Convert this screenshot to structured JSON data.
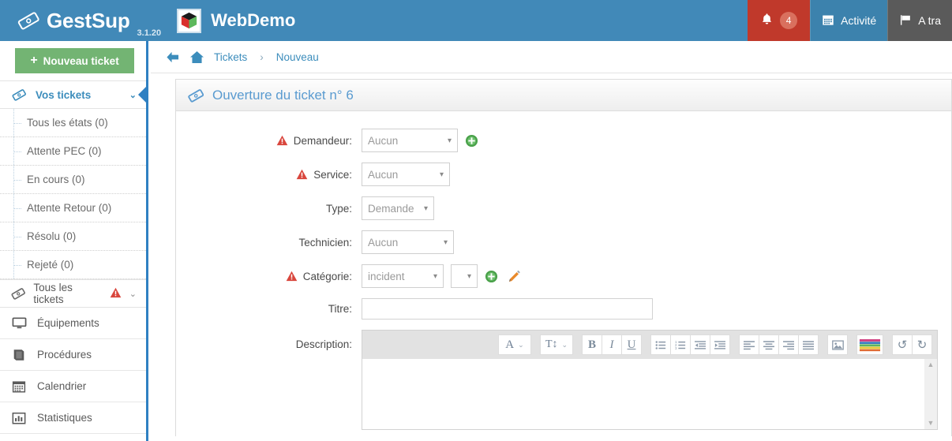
{
  "header": {
    "brand_name": "GestSup",
    "brand_version": "3.1.20",
    "brand_icon": "ticket-icon",
    "site_name": "WebDemo",
    "site_logo_icon": "cube-logo-icon",
    "notifications": {
      "icon": "bell-icon",
      "count": "4"
    },
    "activity": {
      "icon": "calendar-icon",
      "label": "Activité"
    },
    "flag_item": {
      "icon": "flag-icon",
      "label": "A tra"
    },
    "bg_color": "#4189b8",
    "notif_bg_color": "#c0392b",
    "flag_bg_color": "#5a5a5a"
  },
  "sidebar": {
    "new_ticket_button": {
      "label": "Nouveau ticket",
      "icon": "plus-icon",
      "color": "#73b473"
    },
    "groups": {
      "vos_tickets": {
        "label": "Vos tickets",
        "icon": "ticket-icon",
        "chevron": "chevron-down-icon"
      },
      "tous_les_tickets": {
        "label": "Tous les tickets",
        "icon": "ticket-icon",
        "warning": "warning-triangle-icon",
        "chevron": "chevron-down-icon"
      }
    },
    "sub_items": [
      {
        "label": "Tous les états (0)"
      },
      {
        "label": "Attente PEC (0)"
      },
      {
        "label": "En cours (0)"
      },
      {
        "label": "Attente Retour (0)"
      },
      {
        "label": "Résolu (0)"
      },
      {
        "label": "Rejeté (0)"
      }
    ],
    "items": [
      {
        "label": "Équipements",
        "icon": "monitor-icon"
      },
      {
        "label": "Procédures",
        "icon": "book-icon"
      },
      {
        "label": "Calendrier",
        "icon": "calendar-icon"
      },
      {
        "label": "Statistiques",
        "icon": "bar-chart-icon"
      }
    ],
    "accent_color": "#2f80c2"
  },
  "breadcrumb": {
    "back_icon": "arrow-left-icon",
    "home_icon": "home-icon",
    "items": [
      "Tickets",
      "Nouveau"
    ],
    "separator": "›"
  },
  "panel": {
    "title": "Ouverture du ticket n° 6",
    "title_icon": "ticket-icon"
  },
  "form": {
    "rows": [
      {
        "label": "Demandeur:",
        "required": true,
        "value": "Aucun",
        "add_icon": "add-circle-icon"
      },
      {
        "label": "Service:",
        "required": true,
        "value": "Aucun"
      },
      {
        "label": "Type:",
        "required": false,
        "value": "Demande"
      },
      {
        "label": "Technicien:",
        "required": false,
        "value": "Aucun"
      },
      {
        "label": "Catégorie:",
        "required": true,
        "value": "incident",
        "value2": "",
        "add_icon": "add-circle-icon",
        "edit_icon": "pencil-icon"
      },
      {
        "label": "Titre:",
        "required": false,
        "value": ""
      },
      {
        "label": "Description:",
        "required": false,
        "value": ""
      }
    ],
    "required_icon": "warning-triangle-icon",
    "caret": "▾"
  },
  "editor": {
    "toolbar": [
      {
        "name": "font-color-button",
        "glyph": "A",
        "caret": "⌄"
      },
      {
        "name": "font-size-button",
        "glyph": "T↕",
        "caret": "⌄"
      },
      {
        "name": "bold-button",
        "glyph": "B"
      },
      {
        "name": "italic-button",
        "glyph": "I"
      },
      {
        "name": "underline-button",
        "glyph": "U"
      },
      {
        "name": "bullet-list-button",
        "glyph": "☰"
      },
      {
        "name": "numbered-list-button",
        "glyph": "☰"
      },
      {
        "name": "outdent-button",
        "glyph": "☰"
      },
      {
        "name": "indent-button",
        "glyph": "☰"
      },
      {
        "name": "align-left-button",
        "glyph": "☰"
      },
      {
        "name": "align-center-button",
        "glyph": "☰"
      },
      {
        "name": "align-right-button",
        "glyph": "☰"
      },
      {
        "name": "justify-button",
        "glyph": "☰"
      },
      {
        "name": "insert-image-button",
        "glyph": "🖼"
      },
      {
        "name": "color-palette-button",
        "glyph": "▤"
      },
      {
        "name": "undo-button",
        "glyph": "↺"
      },
      {
        "name": "redo-button",
        "glyph": "↻"
      }
    ],
    "content": "",
    "scroll_up": "▲",
    "scroll_down": "▼"
  }
}
